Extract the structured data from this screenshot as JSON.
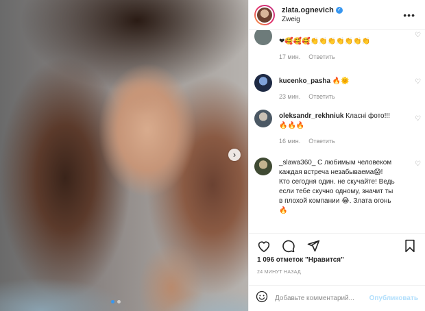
{
  "post": {
    "username": "zlata.ognevich",
    "subtitle": "Zweig",
    "more_label": "•••",
    "verified_mark": "✓"
  },
  "media": {
    "next_label": "›",
    "dots": [
      true,
      false
    ]
  },
  "comments": [
    {
      "username": "",
      "text": "❤🥰🥰🥰👏👏👏👏👏👏👏",
      "time": "17 мин.",
      "reply": "Ответить",
      "avatar_color": "#6d7b7a"
    },
    {
      "username": "kucenko_pasha",
      "text": " 🔥🌞",
      "time": "23 мин.",
      "reply": "Ответить",
      "avatar_color": "#2b3a55"
    },
    {
      "username": "oleksandr_rekhniuk",
      "text": " Класні фото!!!🔥🔥🔥",
      "time": "16 мин.",
      "reply": "Ответить",
      "avatar_color": "#5a6b78"
    },
    {
      "username": "_slawa360_",
      "text": " С любимым человеком каждая встреча незабываема😱! Кто сегодня один. не скучайте! Ведь если тебе скучно одному, значит ты в плохой компании 😂. Злата огонь 🔥",
      "avatar_color": "#4a5a3a"
    }
  ],
  "actions": {
    "like_icon": "heart-icon",
    "comment_icon": "comment-icon",
    "share_icon": "share-icon",
    "save_icon": "bookmark-icon"
  },
  "likes_text": "1 096 отметок \"Нравится\"",
  "time_ago": "24 МИНУТ НАЗАД",
  "add_comment": {
    "placeholder": "Добавьте комментарий...",
    "publish_label": "Опубликовать",
    "emoji_icon": "smile-icon"
  },
  "colors": {
    "accent": "#3897f0",
    "publish_disabled": "#b2dffc",
    "muted": "#8e8e8e"
  }
}
